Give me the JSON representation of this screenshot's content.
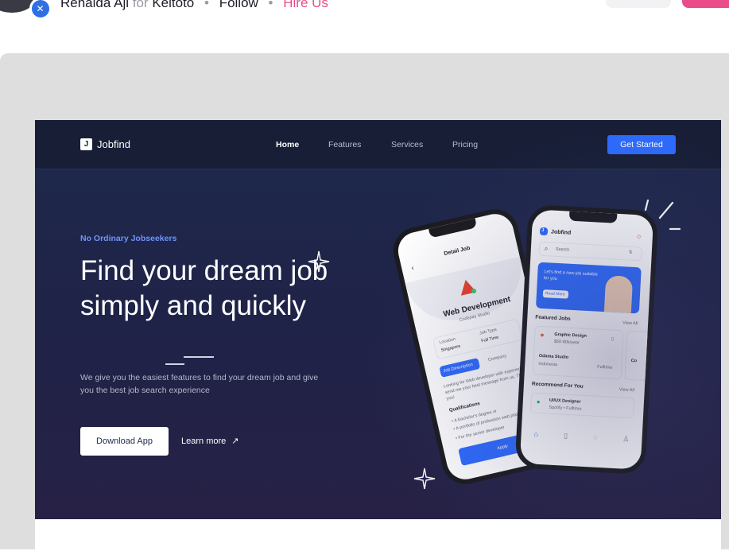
{
  "byline": {
    "author": "Renalda Aji",
    "for": "for",
    "team": "Keitoto",
    "follow": "Follow",
    "hire": "Hire Us",
    "badge": "✕"
  },
  "site": {
    "logo_mark": "J",
    "logo_text": "Jobfind",
    "nav": [
      "Home",
      "Features",
      "Services",
      "Pricing"
    ],
    "cta": "Get Started",
    "eyebrow": "No Ordinary Jobseekers",
    "headline": "Find your dream job simply and quickly",
    "subtext": "We give you the easiest features to find your dream job and give you the best job search experience",
    "download": "Download App",
    "learn": "Learn more",
    "learn_arrow": "↗"
  },
  "phone_detail": {
    "title": "Detail Job",
    "job": "Web Development",
    "company": "Codepay Studio",
    "location_label": "Location",
    "location": "Singapore",
    "type_label": "Job Type",
    "type": "Full Time",
    "tab_desc": "Job Description",
    "tab_company": "Company",
    "desc": "Looking for Web developer with experience send me your best message from us. Thank you!",
    "qual_title": "Qualifications",
    "qual_1": "• A bachelor's degree or",
    "qual_2": "• A portfolio of profession web platforms",
    "qual_3": "• For the senior developer",
    "apply": "Apply"
  },
  "phone_home": {
    "brand": "Jobfind",
    "search": "Search",
    "banner": "Let's find a new job suitable for you",
    "banner_btn": "Read More",
    "featured": "Featured Jobs",
    "view_all": "View All",
    "job1": "Graphic Design",
    "job1_sub": "$50-80k/year",
    "job1_co": "Odama Studio",
    "job1_loc": "Indonesia",
    "job1_type": "Fulltime",
    "job2": "Co",
    "recommend": "Recommend For You",
    "view_all2": "View All",
    "rec1": "UI/UX Designer",
    "rec1_sub": "Spotify • Fulltime"
  },
  "colors": {
    "accent": "#2d6bff",
    "pink": "#ea4c89",
    "eyebrow": "#6f93ff"
  }
}
